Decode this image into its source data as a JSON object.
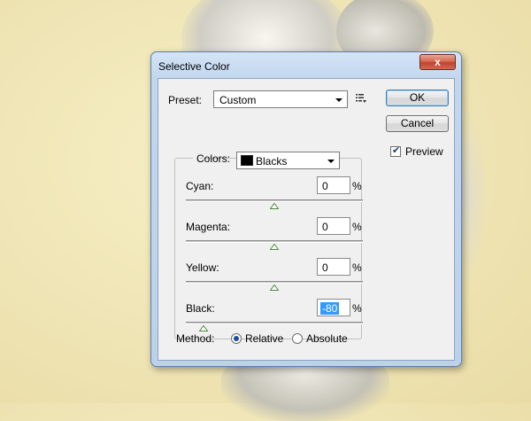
{
  "dialog": {
    "title": "Selective Color",
    "close_glyph": "x"
  },
  "preset": {
    "label": "Preset:",
    "value": "Custom"
  },
  "buttons": {
    "ok": "OK",
    "cancel": "Cancel"
  },
  "preview": {
    "label": "Preview",
    "checked": true
  },
  "colors": {
    "label": "Colors:",
    "value": "Blacks",
    "swatch": "#000000"
  },
  "sliders": [
    {
      "label": "Cyan:",
      "value": "0",
      "unit": "%",
      "fraction": 0.5
    },
    {
      "label": "Magenta:",
      "value": "0",
      "unit": "%",
      "fraction": 0.5
    },
    {
      "label": "Yellow:",
      "value": "0",
      "unit": "%",
      "fraction": 0.5
    },
    {
      "label": "Black:",
      "value": "-80",
      "unit": "%",
      "fraction": 0.1
    }
  ],
  "method": {
    "label": "Method:",
    "options": [
      "Relative",
      "Absolute"
    ],
    "selected": "Relative"
  },
  "colors_accent": {
    "thumb": "#4a8a3a",
    "selection": "#3399ff"
  }
}
